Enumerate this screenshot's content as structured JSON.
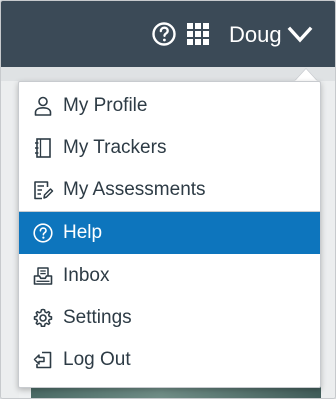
{
  "topbar": {
    "user_name": "Doug"
  },
  "menu": {
    "items": [
      {
        "label": "My Profile",
        "icon": "user-icon",
        "active": false
      },
      {
        "label": "My Trackers",
        "icon": "notebook-icon",
        "active": false
      },
      {
        "label": "My Assessments",
        "icon": "assessment-icon",
        "active": false
      },
      {
        "label": "Help",
        "icon": "help-icon",
        "active": true
      },
      {
        "label": "Inbox",
        "icon": "inbox-icon",
        "active": false
      },
      {
        "label": "Settings",
        "icon": "gear-icon",
        "active": false
      },
      {
        "label": "Log Out",
        "icon": "logout-icon",
        "active": false
      }
    ]
  },
  "colors": {
    "topbar": "#3b4a57",
    "active_item": "#0d75bd",
    "text": "#2d3b45"
  }
}
